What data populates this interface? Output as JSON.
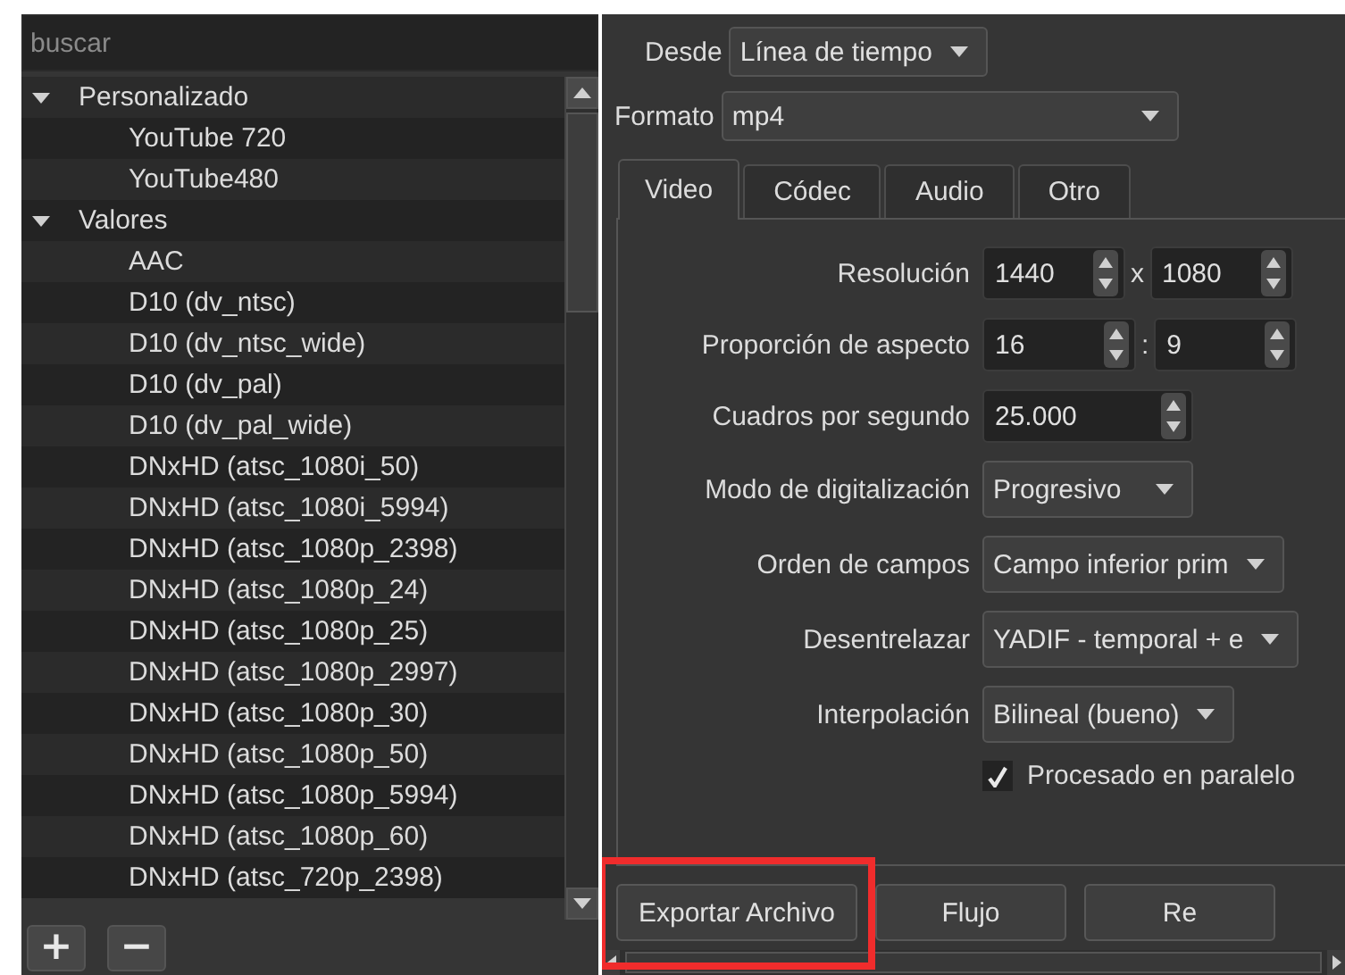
{
  "search": {
    "placeholder": "buscar"
  },
  "presets": [
    {
      "label": "Personalizado",
      "expanded": true,
      "children": [
        {
          "label": "YouTube 720"
        },
        {
          "label": "YouTube480"
        }
      ]
    },
    {
      "label": "Valores",
      "expanded": true,
      "children": [
        {
          "label": "AAC"
        },
        {
          "label": "D10 (dv_ntsc)"
        },
        {
          "label": "D10 (dv_ntsc_wide)"
        },
        {
          "label": "D10 (dv_pal)"
        },
        {
          "label": "D10 (dv_pal_wide)"
        },
        {
          "label": "DNxHD (atsc_1080i_50)"
        },
        {
          "label": "DNxHD (atsc_1080i_5994)"
        },
        {
          "label": "DNxHD (atsc_1080p_2398)"
        },
        {
          "label": "DNxHD (atsc_1080p_24)"
        },
        {
          "label": "DNxHD (atsc_1080p_25)"
        },
        {
          "label": "DNxHD (atsc_1080p_2997)"
        },
        {
          "label": "DNxHD (atsc_1080p_30)"
        },
        {
          "label": "DNxHD (atsc_1080p_50)"
        },
        {
          "label": "DNxHD (atsc_1080p_5994)"
        },
        {
          "label": "DNxHD (atsc_1080p_60)"
        },
        {
          "label": "DNxHD (atsc_720p_2398)"
        }
      ]
    }
  ],
  "preset_buttons": [
    {
      "label": "+"
    },
    {
      "label": "−"
    }
  ],
  "source": {
    "label": "Desde",
    "value": "Línea de tiempo"
  },
  "format": {
    "label": "Formato",
    "value": "mp4"
  },
  "tabs": [
    {
      "label": "Video",
      "selected": true
    },
    {
      "label": "Códec",
      "selected": false
    },
    {
      "label": "Audio",
      "selected": false
    },
    {
      "label": "Otro",
      "selected": false
    }
  ],
  "video_settings": [
    {
      "kind": "spin_pair",
      "label": "Resolución",
      "values": [
        "1440",
        "1080"
      ],
      "separator": "x"
    },
    {
      "kind": "spin_pair",
      "label": "Proporción de aspecto",
      "values": [
        "16",
        "9"
      ],
      "separator": ":"
    },
    {
      "kind": "spin",
      "label": "Cuadros por segundo",
      "value": "25.000"
    },
    {
      "kind": "combo",
      "label": "Modo de digitalización",
      "value": "Progresivo"
    },
    {
      "kind": "combo",
      "label": "Orden de campos",
      "value": "Campo inferior prim"
    },
    {
      "kind": "combo",
      "label": "Desentrelazar",
      "value": "YADIF - temporal + e"
    },
    {
      "kind": "combo",
      "label": "Interpolación",
      "value": "Bilineal (bueno)"
    },
    {
      "kind": "checkbox",
      "label": "Procesado en paralelo",
      "checked": true
    }
  ],
  "actions": [
    {
      "label": "Exportar Archivo",
      "highlighted": true
    },
    {
      "label": "Flujo",
      "highlighted": false
    },
    {
      "label": "Re",
      "highlighted": false
    }
  ]
}
